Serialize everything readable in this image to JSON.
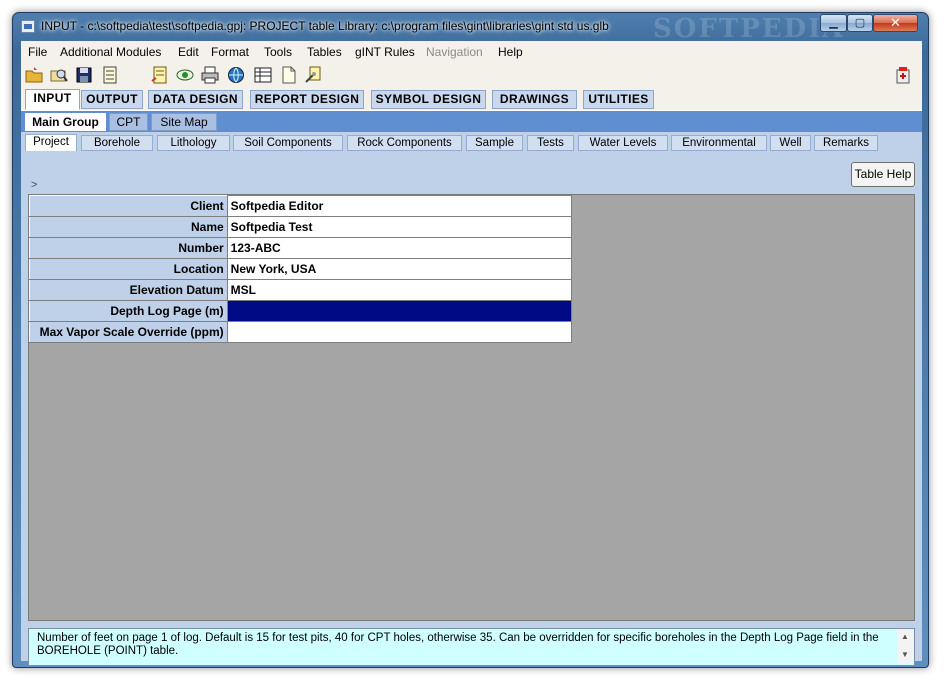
{
  "window": {
    "title": "INPUT - c:\\softpedia\\test\\softpedia.gpj: PROJECT table  Library: c:\\program files\\gint\\libraries\\gint std us.glb",
    "watermark": "SOFTPEDIA"
  },
  "menu": [
    "File",
    "Additional Modules",
    "Edit",
    "Format",
    "Tools",
    "Tables",
    "gINT Rules",
    "Navigation",
    "Help"
  ],
  "main_tabs": [
    "INPUT",
    "OUTPUT",
    "DATA DESIGN",
    "REPORT DESIGN",
    "SYMBOL DESIGN",
    "DRAWINGS",
    "UTILITIES"
  ],
  "group_tabs": [
    "Main Group",
    "CPT",
    "Site Map"
  ],
  "table_tabs": [
    "Project",
    "Borehole",
    "Lithology",
    "Soil Components",
    "Rock Components",
    "Sample",
    "Tests",
    "Water Levels",
    "Environmental",
    "Well",
    "Remarks"
  ],
  "table_help_label": "Table Help",
  "row_indicator": ">",
  "fields": [
    {
      "label": "Client",
      "value": "Softpedia Editor"
    },
    {
      "label": "Name",
      "value": "Softpedia Test"
    },
    {
      "label": "Number",
      "value": "123-ABC"
    },
    {
      "label": "Location",
      "value": "New York, USA"
    },
    {
      "label": "Elevation Datum",
      "value": "MSL"
    },
    {
      "label": "Depth Log Page (m)",
      "value": ""
    },
    {
      "label": "Max Vapor Scale Override (ppm)",
      "value": ""
    }
  ],
  "status_text": "Number of feet on page 1 of log.  Default is 15 for test pits, 40 for CPT holes, otherwise 35.  Can be overridden for specific boreholes in the Depth Log Page field in the BOREHOLE (POINT) table.",
  "colors": {
    "selected_cell": "#000a84",
    "group_bar": "#5f8fd0",
    "status_bg": "#cfffff"
  }
}
